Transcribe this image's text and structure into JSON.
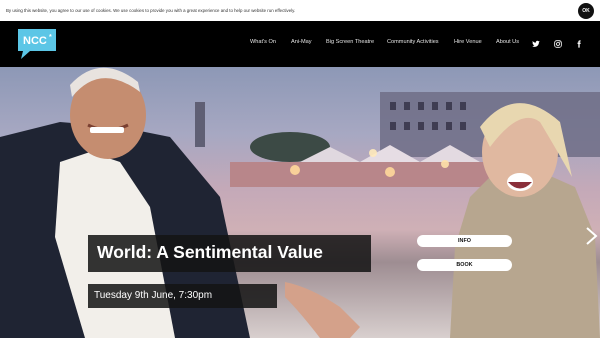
{
  "cookie_bar": {
    "message": "By using this website, you agree to our use of cookies. We use cookies to provide you with a great experience and to help our website run effectively.",
    "ok_label": "OK"
  },
  "logo": {
    "text": "NCC"
  },
  "nav": {
    "items": [
      "What's On",
      "Ani-May",
      "Big Screen Theatre",
      "Community Activities",
      "Hire Venue",
      "About Us"
    ],
    "social": [
      "twitter-icon",
      "instagram-icon",
      "facebook-icon"
    ]
  },
  "hero": {
    "title": "World: A Sentimental Value",
    "date": "Tuesday 9th June, 7:30pm",
    "info_label": "INFO",
    "book_label": "BOOK",
    "next_arrow": "chevron-right-icon"
  }
}
